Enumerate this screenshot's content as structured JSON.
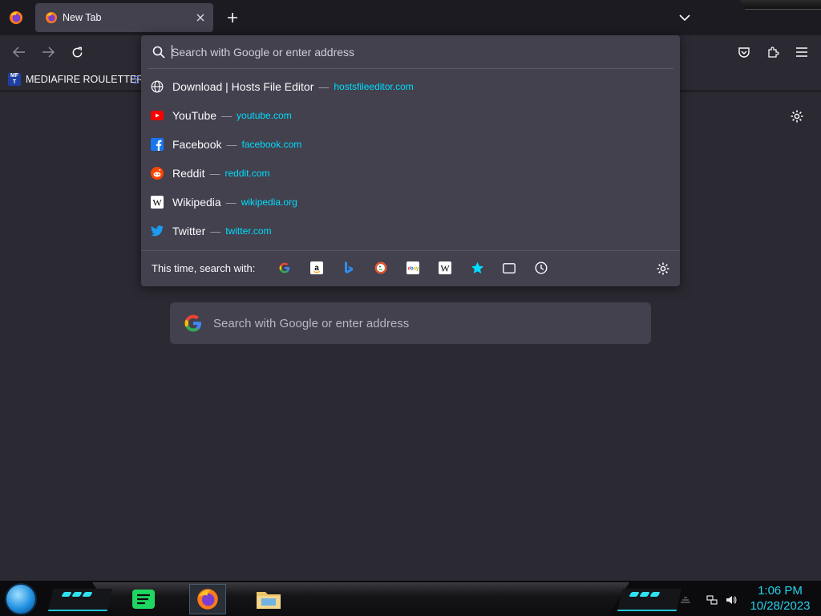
{
  "browser": {
    "tab": {
      "title": "New Tab",
      "favicon": "firefox-icon"
    },
    "toolbar": {
      "back": "back-arrow-icon",
      "forward": "forward-arrow-icon",
      "reload": "reload-icon",
      "right_icons": [
        "pocket-icon",
        "extensions-icon",
        "hamburger-menu-icon"
      ]
    },
    "bookmarks": [
      {
        "icon_text": "MF T",
        "label": "MEDIAFIRE ROULETTER"
      }
    ]
  },
  "urlbar": {
    "placeholder": "Search with Google or enter address",
    "value": "",
    "results": [
      {
        "icon": "globe-icon",
        "title": "Download | Hosts File Editor",
        "separator": "—",
        "url": "hostsfileeditor.com"
      },
      {
        "icon": "youtube-icon",
        "title": "YouTube",
        "separator": "—",
        "url": "youtube.com"
      },
      {
        "icon": "facebook-icon",
        "title": "Facebook",
        "separator": "—",
        "url": "facebook.com"
      },
      {
        "icon": "reddit-icon",
        "title": "Reddit",
        "separator": "—",
        "url": "reddit.com"
      },
      {
        "icon": "wikipedia-icon",
        "title": "Wikipedia",
        "separator": "—",
        "url": "wikipedia.org"
      },
      {
        "icon": "twitter-icon",
        "title": "Twitter",
        "separator": "—",
        "url": "twitter.com"
      }
    ],
    "oneoff": {
      "label": "This time, search with:",
      "engines": [
        "google-icon",
        "amazon-icon",
        "bing-icon",
        "duckduckgo-icon",
        "ebay-icon",
        "wikipedia-icon",
        "bookmarks-star-icon",
        "tabs-icon",
        "history-icon"
      ]
    }
  },
  "newtab": {
    "search_placeholder": "Search with Google or enter address"
  },
  "taskbar": {
    "clock_time": "1:06 PM",
    "clock_date": "10/28/2023",
    "apps": [
      "spotify-icon",
      "firefox-icon",
      "file-explorer-icon"
    ],
    "tray": [
      "network-icon",
      "volume-icon"
    ]
  },
  "colors": {
    "accent_url": "#00ddff",
    "panel": "#42414d",
    "background": "#2b2a33",
    "clock": "#23d3ea"
  }
}
